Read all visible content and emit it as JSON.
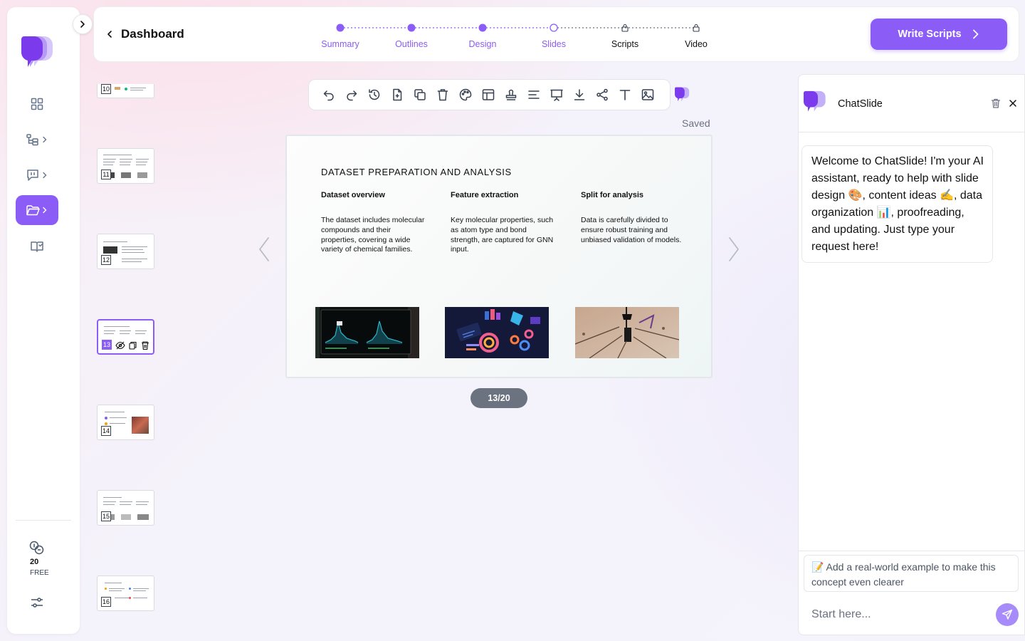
{
  "header": {
    "back_label": "Dashboard",
    "steps": [
      {
        "label": "Summary",
        "state": "done"
      },
      {
        "label": "Outlines",
        "state": "done"
      },
      {
        "label": "Design",
        "state": "done"
      },
      {
        "label": "Slides",
        "state": "current"
      },
      {
        "label": "Scripts",
        "state": "locked"
      },
      {
        "label": "Video",
        "state": "locked"
      }
    ],
    "primary_button": "Write Scripts"
  },
  "sidebar": {
    "items": [
      {
        "name": "dashboard",
        "icon": "grid-icon"
      },
      {
        "name": "outline",
        "icon": "tree-icon"
      },
      {
        "name": "chat",
        "icon": "message-icon"
      },
      {
        "name": "files",
        "icon": "folder-icon",
        "active": true
      },
      {
        "name": "library",
        "icon": "book-icon"
      }
    ],
    "credits": "20",
    "tier": "FREE"
  },
  "thumbnails": [
    "10",
    "11",
    "12",
    "13",
    "14",
    "15",
    "16"
  ],
  "toolbar": {
    "status": "Saved",
    "tools": [
      "undo-icon",
      "redo-icon",
      "history-icon",
      "add-page-icon",
      "duplicate-icon",
      "delete-icon",
      "palette-icon",
      "layout-icon",
      "stamp-icon",
      "align-icon",
      "present-icon",
      "download-icon",
      "share-icon",
      "text-icon",
      "image-icon"
    ]
  },
  "slide": {
    "title": "DATASET PREPARATION AND ANALYSIS",
    "columns": [
      {
        "heading": "Dataset overview",
        "body": "The dataset includes molecular compounds and their properties, covering a wide variety of chemical families."
      },
      {
        "heading": "Feature extraction",
        "body": "Key molecular properties, such as atom type and bond strength, are captured for GNN input."
      },
      {
        "heading": "Split for analysis",
        "body": "Data is carefully divided to ensure robust training and unbiased validation of models."
      }
    ]
  },
  "pager": "13/20",
  "chat": {
    "title": "ChatSlide",
    "welcome": "Welcome to ChatSlide! I'm your AI assistant, ready to help with slide design 🎨, content ideas ✍️, data organization 📊, proofreading, and updating. Just type your request here!",
    "suggestion": "📝 Add a real-world example to make this concept even clearer",
    "input_placeholder": "Start here..."
  },
  "colors": {
    "accent": "#8b5cf6",
    "pager_bg": "#6b7280"
  }
}
